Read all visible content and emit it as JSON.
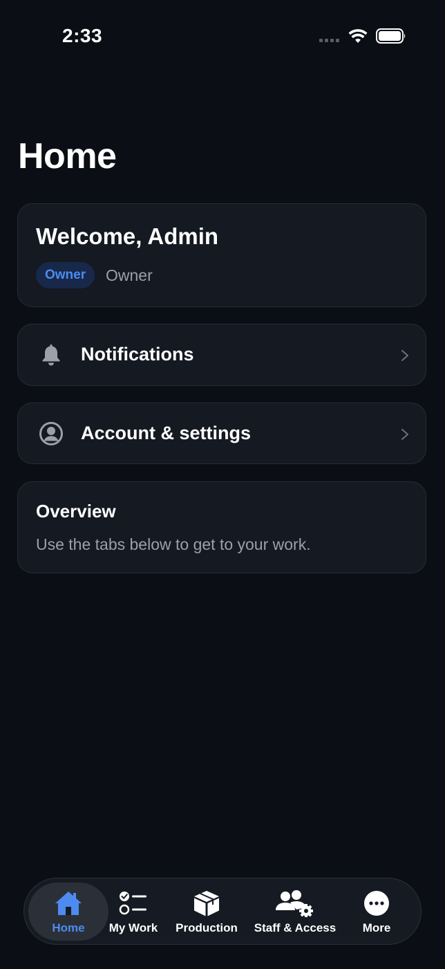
{
  "status_bar": {
    "time": "2:33"
  },
  "header": {
    "title": "Home"
  },
  "welcome": {
    "greeting": "Welcome, Admin",
    "role_badge": "Owner",
    "role_text": "Owner"
  },
  "rows": {
    "notifications": {
      "label": "Notifications",
      "icon": "bell-icon"
    },
    "account": {
      "label": "Account & settings",
      "icon": "user-circle-icon"
    }
  },
  "overview": {
    "title": "Overview",
    "description": "Use the tabs below to get to your work."
  },
  "tabs": [
    {
      "label": "Home",
      "icon": "house-icon",
      "active": true
    },
    {
      "label": "My Work",
      "icon": "checklist-icon",
      "active": false
    },
    {
      "label": "Production",
      "icon": "box-icon",
      "active": false
    },
    {
      "label": "Staff & Access",
      "icon": "staff-gear-icon",
      "active": false
    },
    {
      "label": "More",
      "icon": "more-icon",
      "active": false
    }
  ],
  "colors": {
    "background": "#0b0f15",
    "card": "#141922",
    "accent": "#4d8bf0",
    "muted_text": "#9aa1ab"
  }
}
